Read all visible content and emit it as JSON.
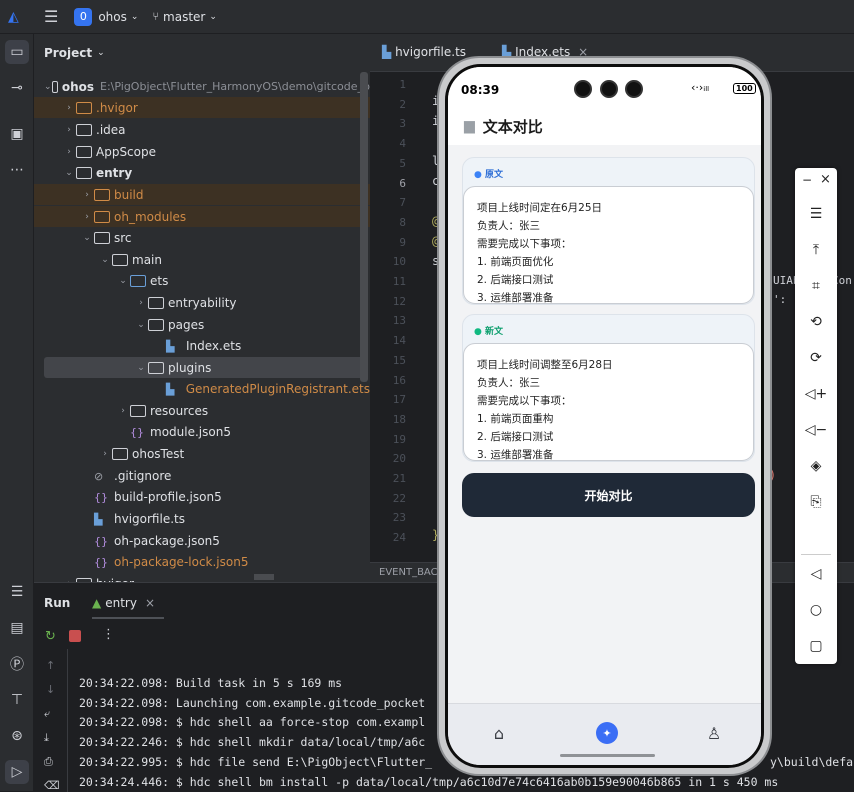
{
  "topbar": {
    "menu_icon": "hamburger-icon",
    "project_initial": "0",
    "project_name": "ohos",
    "branch": "master"
  },
  "project_panel": {
    "title": "Project",
    "root_name": "ohos",
    "root_path": "E:\\PigObject\\Flutter_HarmonyOS\\demo\\gitcode_p",
    "items": [
      {
        "label": ".hvigor"
      },
      {
        "label": ".idea"
      },
      {
        "label": "AppScope"
      },
      {
        "label": "entry"
      },
      {
        "label": "build"
      },
      {
        "label": "oh_modules"
      },
      {
        "label": "src"
      },
      {
        "label": "main"
      },
      {
        "label": "ets"
      },
      {
        "label": "entryability"
      },
      {
        "label": "pages"
      },
      {
        "label": "Index.ets"
      },
      {
        "label": "plugins"
      },
      {
        "label": "GeneratedPluginRegistrant.ets"
      },
      {
        "label": "resources"
      },
      {
        "label": "module.json5"
      },
      {
        "label": "ohosTest"
      },
      {
        "label": ".gitignore"
      },
      {
        "label": "build-profile.json5"
      },
      {
        "label": "hvigorfile.ts"
      },
      {
        "label": "oh-package.json5"
      },
      {
        "label": "oh-package-lock.json5"
      },
      {
        "label": "hvigor"
      }
    ]
  },
  "editor": {
    "tabs": [
      {
        "label": "hvigorfile.ts"
      },
      {
        "label": "Index.ets"
      }
    ],
    "line_numbers": [
      "1",
      "2",
      "3",
      "4",
      "5",
      "6",
      "7",
      "8",
      "9",
      "10",
      "11",
      "12",
      "13",
      "14",
      "15",
      "16",
      "17",
      "18",
      "19",
      "20",
      "21",
      "22",
      "23",
      "24"
    ],
    "current_line": "6",
    "code_fragments": {
      "l2": "i",
      "l3": "i",
      "l5": "l",
      "l6": "c",
      "l8": "@",
      "l9": "@",
      "l10": "s",
      "right_11": "UIAb",
      "right_11b": "Con",
      "right_12": "':",
      "l24": "}"
    },
    "event_bar": "EVENT_BAC"
  },
  "run_panel": {
    "title": "Run",
    "tab": "entry",
    "logs": [
      "20:34:22.098: Build task in 5 s 169 ms",
      "20:34:22.098: Launching com.example.gitcode_pocket",
      "20:34:22.098: $ hdc shell aa force-stop com.exampl",
      "20:34:22.246: $ hdc shell mkdir data/local/tmp/a6c",
      "20:34:22.995: $ hdc file send E:\\PigObject\\Flutter_",
      "20:34:24.446: $ hdc shell bm install -p data/local/tmp/a6c10d7e74c6416ab0b159e90046b865 in 1 s 450 ms"
    ],
    "log_tail_right": "y\\build\\defau"
  },
  "phone": {
    "time": "08:39",
    "battery": "100",
    "page_title": "文本对比",
    "original_label": "原文",
    "original_text": [
      "项目上线时间定在6月25日",
      "负责人：张三",
      "需要完成以下事项：",
      "1. 前端页面优化",
      "2. 后端接口测试",
      "3. 运维部署准备"
    ],
    "new_label": "新文",
    "new_text": [
      "项目上线时间调整至6月28日",
      "负责人：张三",
      "需要完成以下事项：",
      "1. 前端页面重构",
      "2. 后端接口测试",
      "3. 运维部署准备"
    ],
    "compare_button": "开始对比",
    "nav": [
      "home-icon",
      "compass-icon",
      "person-icon"
    ],
    "colors": {
      "original_dot": "#3b82f6",
      "new_dot": "#10b981",
      "button": "#1f2937",
      "nav_active": "#3b6ef5"
    }
  }
}
